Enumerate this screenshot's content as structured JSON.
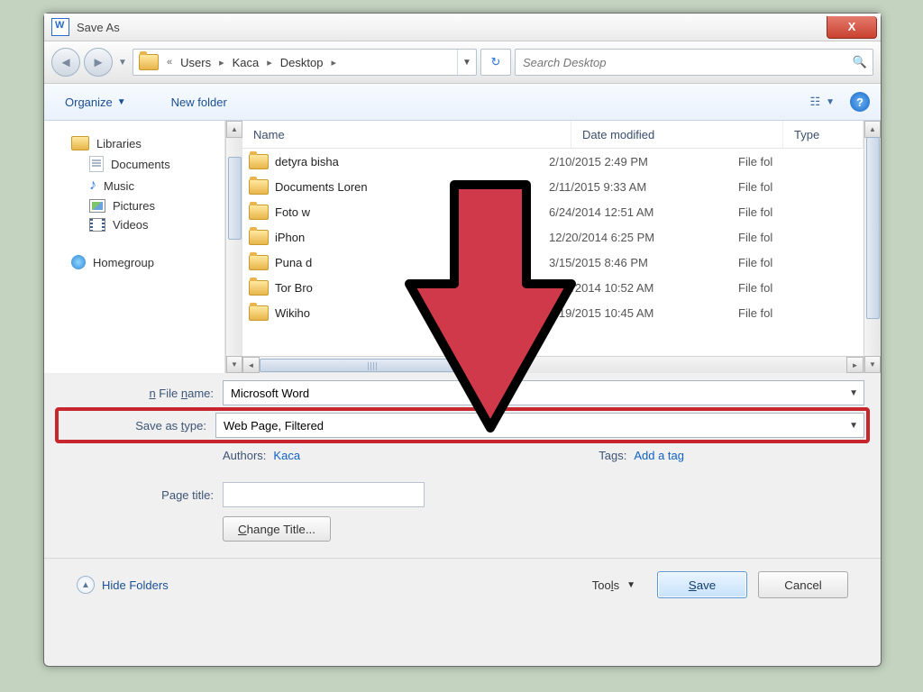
{
  "window": {
    "title": "Save As",
    "close_glyph": "X"
  },
  "nav": {
    "breadcrumb_prefix": "«",
    "segments": [
      "Users",
      "Kaca",
      "Desktop"
    ],
    "search_placeholder": "Search Desktop"
  },
  "toolbar": {
    "organize": "Organize",
    "new_folder": "New folder"
  },
  "sidebar": {
    "libraries": {
      "label": "Libraries",
      "items": [
        {
          "label": "Documents"
        },
        {
          "label": "Music"
        },
        {
          "label": "Pictures"
        },
        {
          "label": "Videos"
        }
      ]
    },
    "homegroup": {
      "label": "Homegroup"
    }
  },
  "filelist": {
    "columns": {
      "name": "Name",
      "date": "Date modified",
      "type": "Type"
    },
    "rows": [
      {
        "name": "detyra bisha",
        "date": "2/10/2015 2:49 PM",
        "type": "File fol"
      },
      {
        "name": "Documents Loren",
        "date": "2/11/2015 9:33 AM",
        "type": "File fol"
      },
      {
        "name": "Foto w",
        "date": "6/24/2014 12:51 AM",
        "type": "File fol"
      },
      {
        "name": "iPhon",
        "date": "12/20/2014 6:25 PM",
        "type": "File fol"
      },
      {
        "name": "Puna d",
        "date": "3/15/2015 8:46 PM",
        "type": "File fol"
      },
      {
        "name": "Tor Bro",
        "date": "6/16/2014 10:52 AM",
        "type": "File fol"
      },
      {
        "name": "Wikiho",
        "date": "3/19/2015 10:45 AM",
        "type": "File fol"
      }
    ]
  },
  "form": {
    "file_name_label": "File name:",
    "file_name_value": "Microsoft Word",
    "save_type_label": "Save as type:",
    "save_type_value": "Web Page, Filtered",
    "authors_label": "Authors:",
    "authors_value": "Kaca",
    "tags_label": "Tags:",
    "tags_value": "Add a tag",
    "page_title_label": "Page title:",
    "page_title_value": "",
    "change_title_btn": "Change Title..."
  },
  "footer": {
    "hide_folders": "Hide Folders",
    "tools": "Tools",
    "save": "Save",
    "cancel": "Cancel"
  },
  "colors": {
    "highlight": "#c7262e",
    "link": "#1062c4",
    "accent": "#1b4f93"
  }
}
